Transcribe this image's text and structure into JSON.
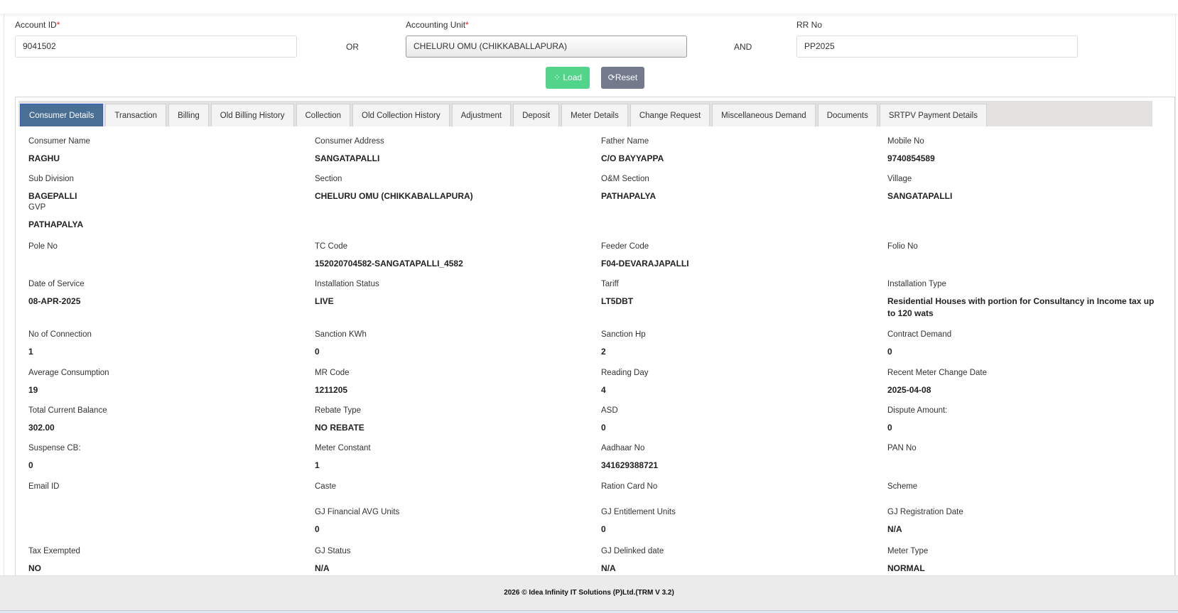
{
  "search": {
    "account_id_label": "Account ID",
    "account_id_value": "9041502",
    "or_label": "OR",
    "accounting_unit_label": "Accounting Unit",
    "accounting_unit_value": "CHELURU OMU (CHIKKABALLAPURA)",
    "and_label": "AND",
    "rr_no_label": "RR No",
    "rr_no_value": "PP2025",
    "required_mark": "*",
    "load_label": "Load",
    "reset_label": "Reset"
  },
  "tabs": [
    {
      "label": "Consumer Details",
      "active": true
    },
    {
      "label": "Transaction"
    },
    {
      "label": "Billing"
    },
    {
      "label": "Old Billing History"
    },
    {
      "label": "Collection"
    },
    {
      "label": "Old Collection History"
    },
    {
      "label": "Adjustment"
    },
    {
      "label": "Deposit"
    },
    {
      "label": "Meter Details"
    },
    {
      "label": "Change Request"
    },
    {
      "label": "Miscellaneous Demand"
    },
    {
      "label": "Documents"
    },
    {
      "label": "SRTPV Payment Details"
    }
  ],
  "details": [
    [
      {
        "label": "Consumer Name",
        "value": "RAGHU"
      },
      {
        "label": "Consumer Address",
        "value": "SANGATAPALLI"
      },
      {
        "label": "Father Name",
        "value": "C/O BAYYAPPA"
      },
      {
        "label": "Mobile No",
        "value": "9740854589"
      }
    ],
    [
      {
        "label": "Sub Division",
        "value": "BAGEPALLI",
        "extra_label": "GVP",
        "extra_value": "PATHAPALYA"
      },
      {
        "label": "Section",
        "value": "CHELURU OMU (CHIKKABALLAPURA)"
      },
      {
        "label": "O&M Section",
        "value": "PATHAPALYA"
      },
      {
        "label": "Village",
        "value": "SANGATAPALLI"
      }
    ],
    [
      {
        "label": "Pole No",
        "value": ""
      },
      {
        "label": "TC Code",
        "value": "152020704582-SANGATAPALLI_4582"
      },
      {
        "label": "Feeder Code",
        "value": "F04-DEVARAJAPALLI"
      },
      {
        "label": "Folio No",
        "value": ""
      }
    ],
    [
      {
        "label": "Date of Service",
        "value": "08-APR-2025"
      },
      {
        "label": "Installation Status",
        "value": "LIVE"
      },
      {
        "label": "Tariff",
        "value": "LT5DBT"
      },
      {
        "label": "Installation Type",
        "value": "Residential Houses with portion for Consultancy in Income tax up to 120 wats"
      }
    ],
    [
      {
        "label": "No of Connection",
        "value": "1"
      },
      {
        "label": "Sanction KWh",
        "value": "0"
      },
      {
        "label": "Sanction Hp",
        "value": "2"
      },
      {
        "label": "Contract Demand",
        "value": "0"
      }
    ],
    [
      {
        "label": "Average Consumption",
        "value": "19"
      },
      {
        "label": "MR Code",
        "value": "1211205"
      },
      {
        "label": "Reading Day",
        "value": "4"
      },
      {
        "label": "Recent Meter Change Date",
        "value": "2025-04-08"
      }
    ],
    [
      {
        "label": "Total Current Balance",
        "value": "302.00"
      },
      {
        "label": "Rebate Type",
        "value": "NO REBATE"
      },
      {
        "label": "ASD",
        "value": "0"
      },
      {
        "label": "Dispute Amount:",
        "value": "0"
      }
    ],
    [
      {
        "label": "Suspense CB:",
        "value": "0"
      },
      {
        "label": "Meter Constant",
        "value": "1"
      },
      {
        "label": "Aadhaar No",
        "value": "341629388721"
      },
      {
        "label": "PAN No",
        "value": ""
      }
    ],
    [
      {
        "label": "Email ID",
        "value": ""
      },
      {
        "label": "Caste",
        "value": ""
      },
      {
        "label": "Ration Card No",
        "value": ""
      },
      {
        "label": "Scheme",
        "value": ""
      }
    ],
    [
      null,
      {
        "label": "GJ Financial AVG Units",
        "value": "0"
      },
      {
        "label": "GJ Entitlement Units",
        "value": "0"
      },
      {
        "label": "GJ Registration Date",
        "value": "N/A"
      }
    ],
    [
      {
        "label": "Tax Exempted",
        "value": "NO"
      },
      {
        "label": "GJ Status",
        "value": "N/A"
      },
      {
        "label": "GJ Delinked date",
        "value": "N/A"
      },
      {
        "label": "Meter Type",
        "value": "NORMAL"
      }
    ]
  ],
  "footer": {
    "text": "2026 © Idea Infinity IT Solutions (P)Ltd.(TRM V 3.2)"
  },
  "colors": {
    "load": "#52d48b",
    "reset": "#727a8c",
    "active_tab": "#4a6f94",
    "required": "#e02020"
  }
}
